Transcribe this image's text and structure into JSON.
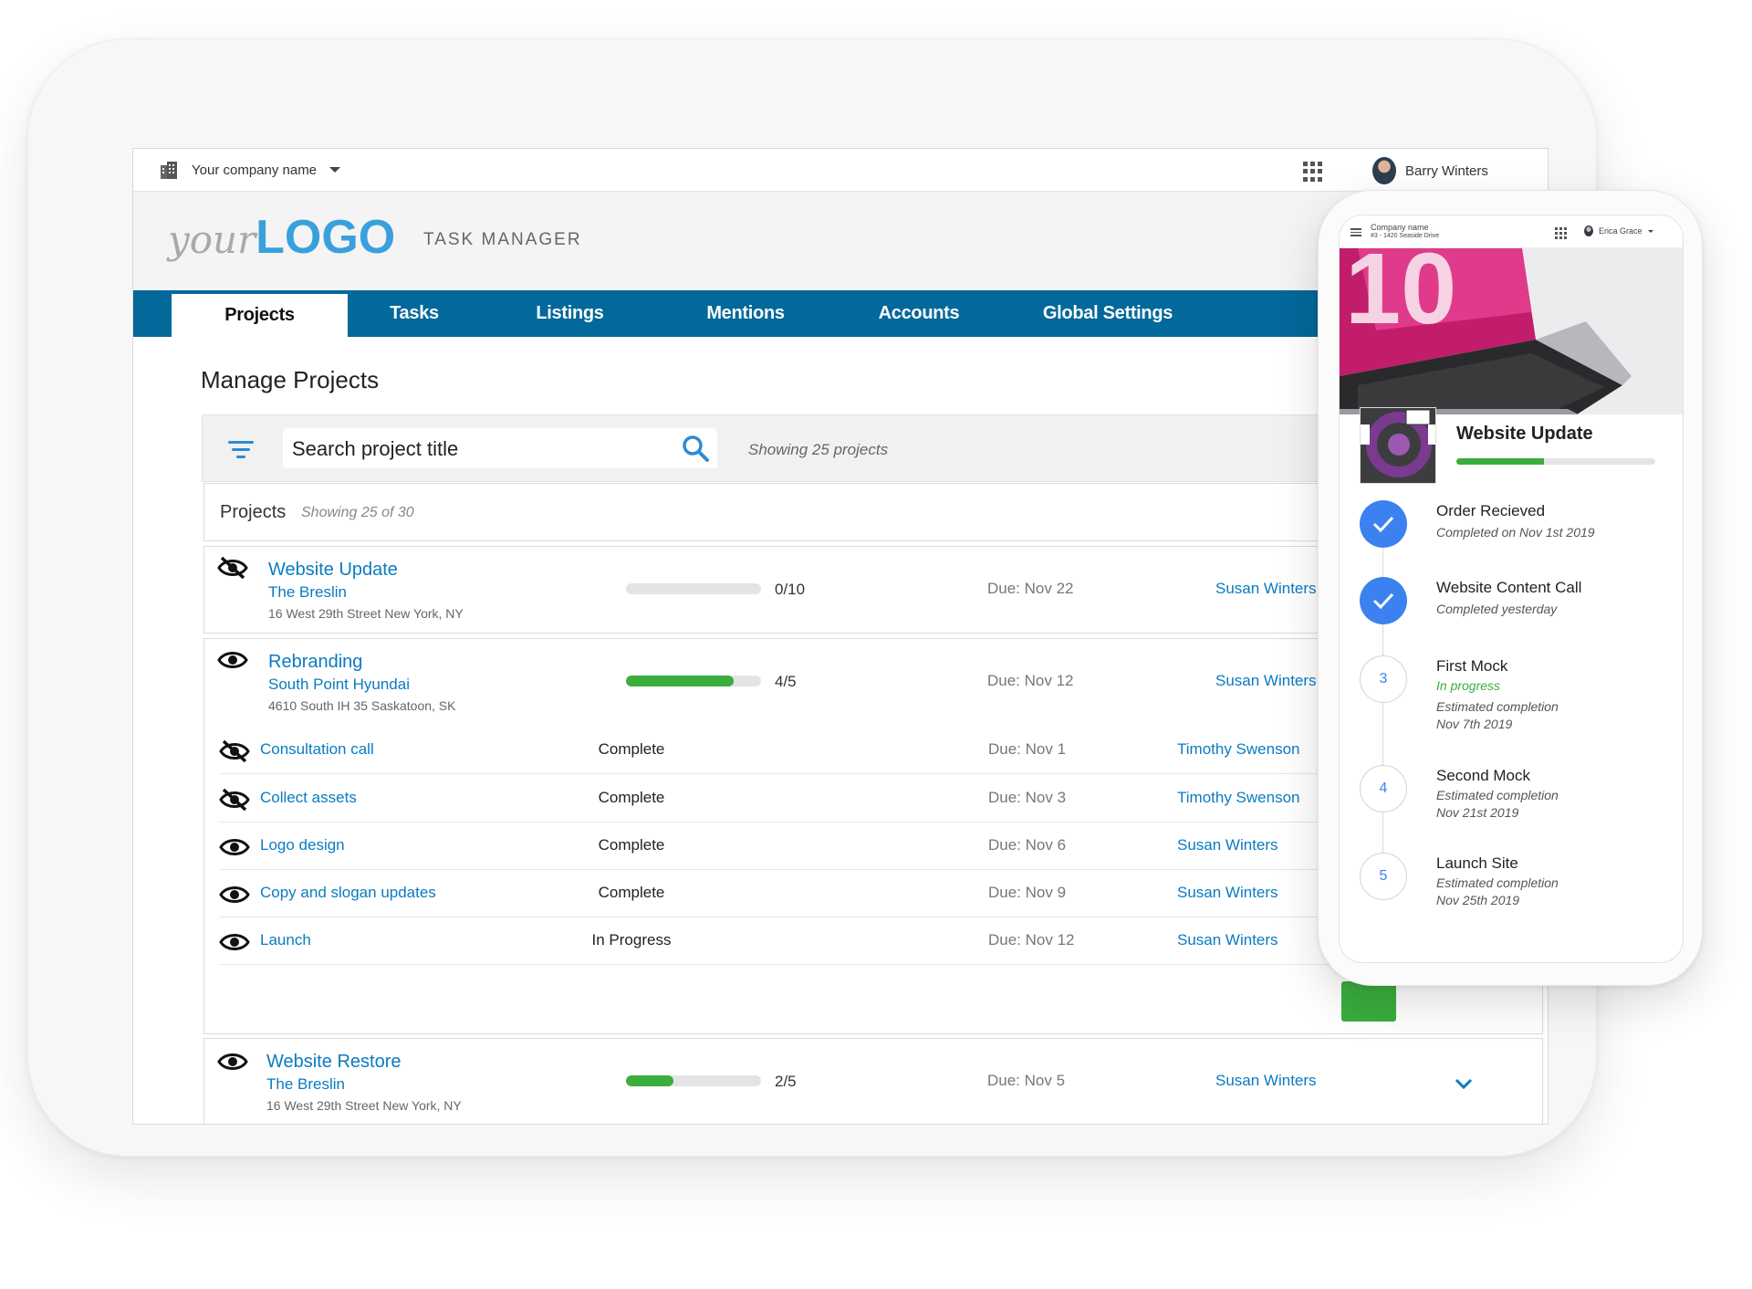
{
  "topbar": {
    "company": "Your company name",
    "user": "Barry Winters"
  },
  "header": {
    "logo_your": "your",
    "logo_main": "LOGO",
    "app_name": "TASK MANAGER"
  },
  "nav": {
    "tabs": [
      "Projects",
      "Tasks",
      "Listings",
      "Mentions",
      "Accounts",
      "Global Settings"
    ],
    "active": "Projects"
  },
  "page": {
    "title": "Manage Projects"
  },
  "search": {
    "placeholder": "Search project title",
    "showing": "Showing 25 projects"
  },
  "projects_header": {
    "title": "Projects",
    "subtitle": "Showing 25 of 30"
  },
  "projects": [
    {
      "title": "Website Update",
      "client": "The Breslin",
      "address": "16 West 29th Street  New York, NY",
      "count": "0/10",
      "progress": 0.0,
      "due": "Due: Nov 22",
      "owner": "Susan Winters",
      "visible": false
    },
    {
      "title": "Rebranding",
      "client": "South Point Hyundai",
      "address": "4610 South IH 35 Saskatoon, SK",
      "count": "4/5",
      "progress": 0.8,
      "due": "Due: Nov 12",
      "owner": "Susan Winters",
      "visible": true,
      "tasks": [
        {
          "name": "Consultation call",
          "status": "Complete",
          "due": "Due: Nov 1",
          "owner": "Timothy Swenson",
          "visible": false
        },
        {
          "name": "Collect assets",
          "status": "Complete",
          "due": "Due: Nov 3",
          "owner": "Timothy Swenson",
          "visible": false
        },
        {
          "name": "Logo design",
          "status": "Complete",
          "due": "Due: Nov 6",
          "owner": "Susan Winters",
          "visible": true
        },
        {
          "name": "Copy and slogan updates",
          "status": "Complete",
          "due": "Due: Nov 9",
          "owner": "Susan Winters",
          "visible": true
        },
        {
          "name": "Launch",
          "status": "In Progress",
          "due": "Due: Nov 12",
          "owner": "Susan Winters",
          "visible": true
        }
      ]
    },
    {
      "title": "Website Restore",
      "client": "The Breslin",
      "address": "16 West 29th Street New York, NY",
      "count": "2/5",
      "progress": 0.35,
      "due": "Due: Nov 5",
      "owner": "Susan Winters",
      "visible": true
    }
  ],
  "mobile": {
    "company": "Company name",
    "company_sub": "#3 - 1420 Seaside Drive",
    "user": "Erica Grace",
    "hero_text": "10",
    "card_title": "Website Update",
    "card_progress": 0.44,
    "steps": [
      {
        "num": "",
        "title": "Order Recieved",
        "lines": [
          "Completed on Nov 1st 2019"
        ],
        "done": true
      },
      {
        "num": "",
        "title": "Website Content Call",
        "lines": [
          "Completed yesterday"
        ],
        "done": true
      },
      {
        "num": "3",
        "title": "First Mock",
        "progress_label": "In progress",
        "lines": [
          "Estimated completion",
          "Nov 7th 2019"
        ],
        "done": false
      },
      {
        "num": "4",
        "title": "Second Mock",
        "lines": [
          "Estimated completion",
          "Nov 21st 2019"
        ],
        "done": false
      },
      {
        "num": "5",
        "title": "Launch Site",
        "lines": [
          "Estimated completion",
          "Nov 25th 2019"
        ],
        "done": false
      }
    ]
  },
  "colors": {
    "nav": "#03689a",
    "link": "#0a7bc2",
    "progress": "#3aad3d",
    "step_done": "#3b82f0",
    "logo": "#3aa0dc"
  },
  "icons": {
    "building": "building-icon",
    "apps": "apps-grid-icon",
    "filter": "filter-icon",
    "search": "search-icon",
    "eye": "eye-icon",
    "eye_off": "eye-off-icon",
    "check": "check-icon",
    "chevron": "chevron-down-icon"
  }
}
